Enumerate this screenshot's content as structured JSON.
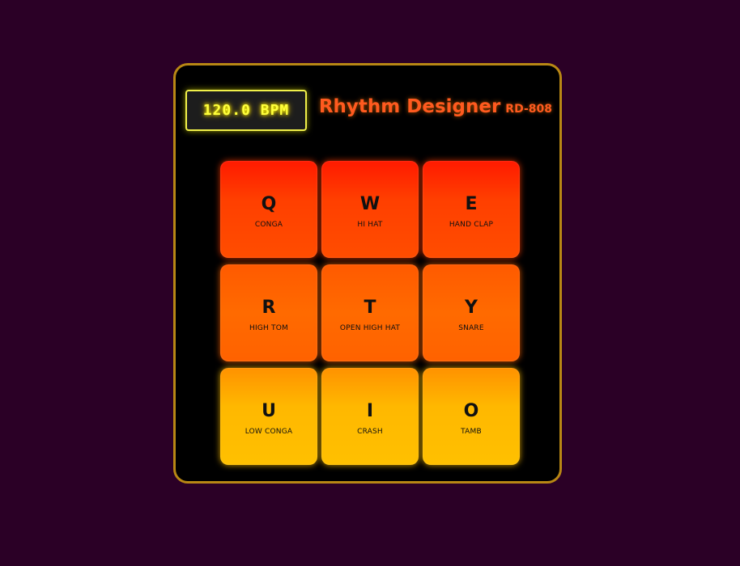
{
  "app": {
    "title": "Rhythm Designer",
    "model": "RD-808"
  },
  "display": {
    "bpm_text": "120.0 BPM"
  },
  "colors": {
    "background": "#2b0026",
    "frame_border": "#b88714",
    "display_text": "#ffff3b",
    "brand": "#ff5a1f"
  },
  "pads": [
    {
      "key": "Q",
      "label": "CONGA"
    },
    {
      "key": "W",
      "label": "HI HAT"
    },
    {
      "key": "E",
      "label": "HAND CLAP"
    },
    {
      "key": "R",
      "label": "HIGH TOM"
    },
    {
      "key": "T",
      "label": "OPEN HIGH HAT"
    },
    {
      "key": "Y",
      "label": "SNARE"
    },
    {
      "key": "U",
      "label": "LOW CONGA"
    },
    {
      "key": "I",
      "label": "CRASH"
    },
    {
      "key": "O",
      "label": "TAMB"
    }
  ]
}
